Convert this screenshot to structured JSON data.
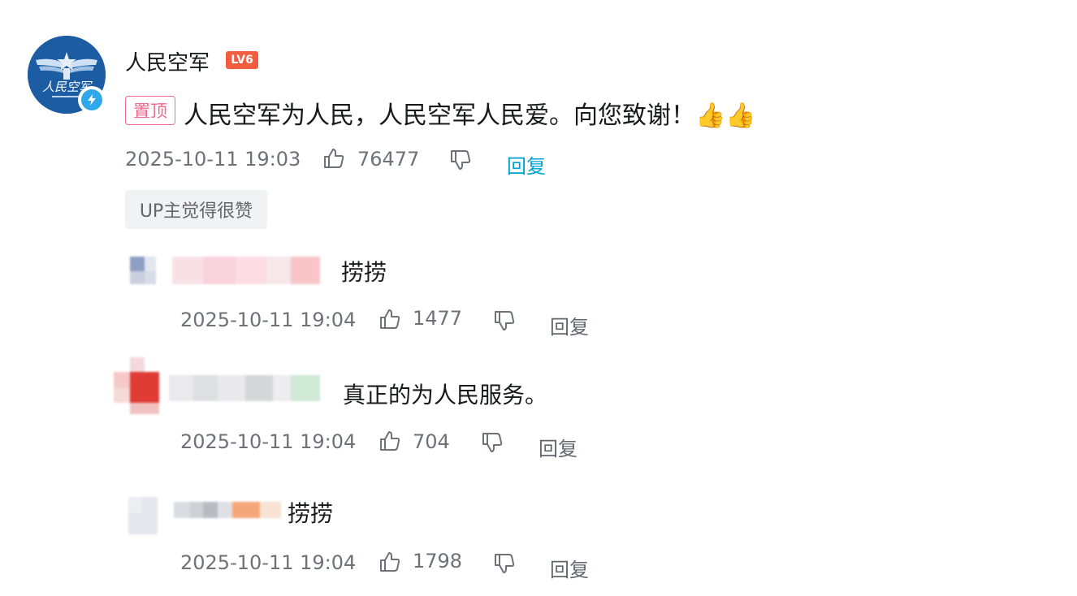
{
  "comment": {
    "username": "人民空军",
    "level_badge": "LV6",
    "pin_label": "置顶",
    "text": "人民空军为人民，人民空军人民爱。向您致谢！👍👍",
    "timestamp": "2025-10-11 19:03",
    "likes": "76477",
    "reply_label": "回复",
    "up_badge": "UP主觉得很赞",
    "avatar_emblem_text": "人民空军",
    "colors": {
      "accent_blue": "#00a1d6",
      "pin_pink": "#f26a8d",
      "level_red": "#f25d3f"
    }
  },
  "replies": [
    {
      "text": "捞捞",
      "timestamp": "2025-10-11 19:04",
      "likes": "1477",
      "reply_label": "回复"
    },
    {
      "text": "真正的为人民服务。",
      "timestamp": "2025-10-11 19:04",
      "likes": "704",
      "reply_label": "回复"
    },
    {
      "text": "捞捞",
      "timestamp": "2025-10-11 19:04",
      "likes": "1798",
      "reply_label": "回复"
    }
  ]
}
